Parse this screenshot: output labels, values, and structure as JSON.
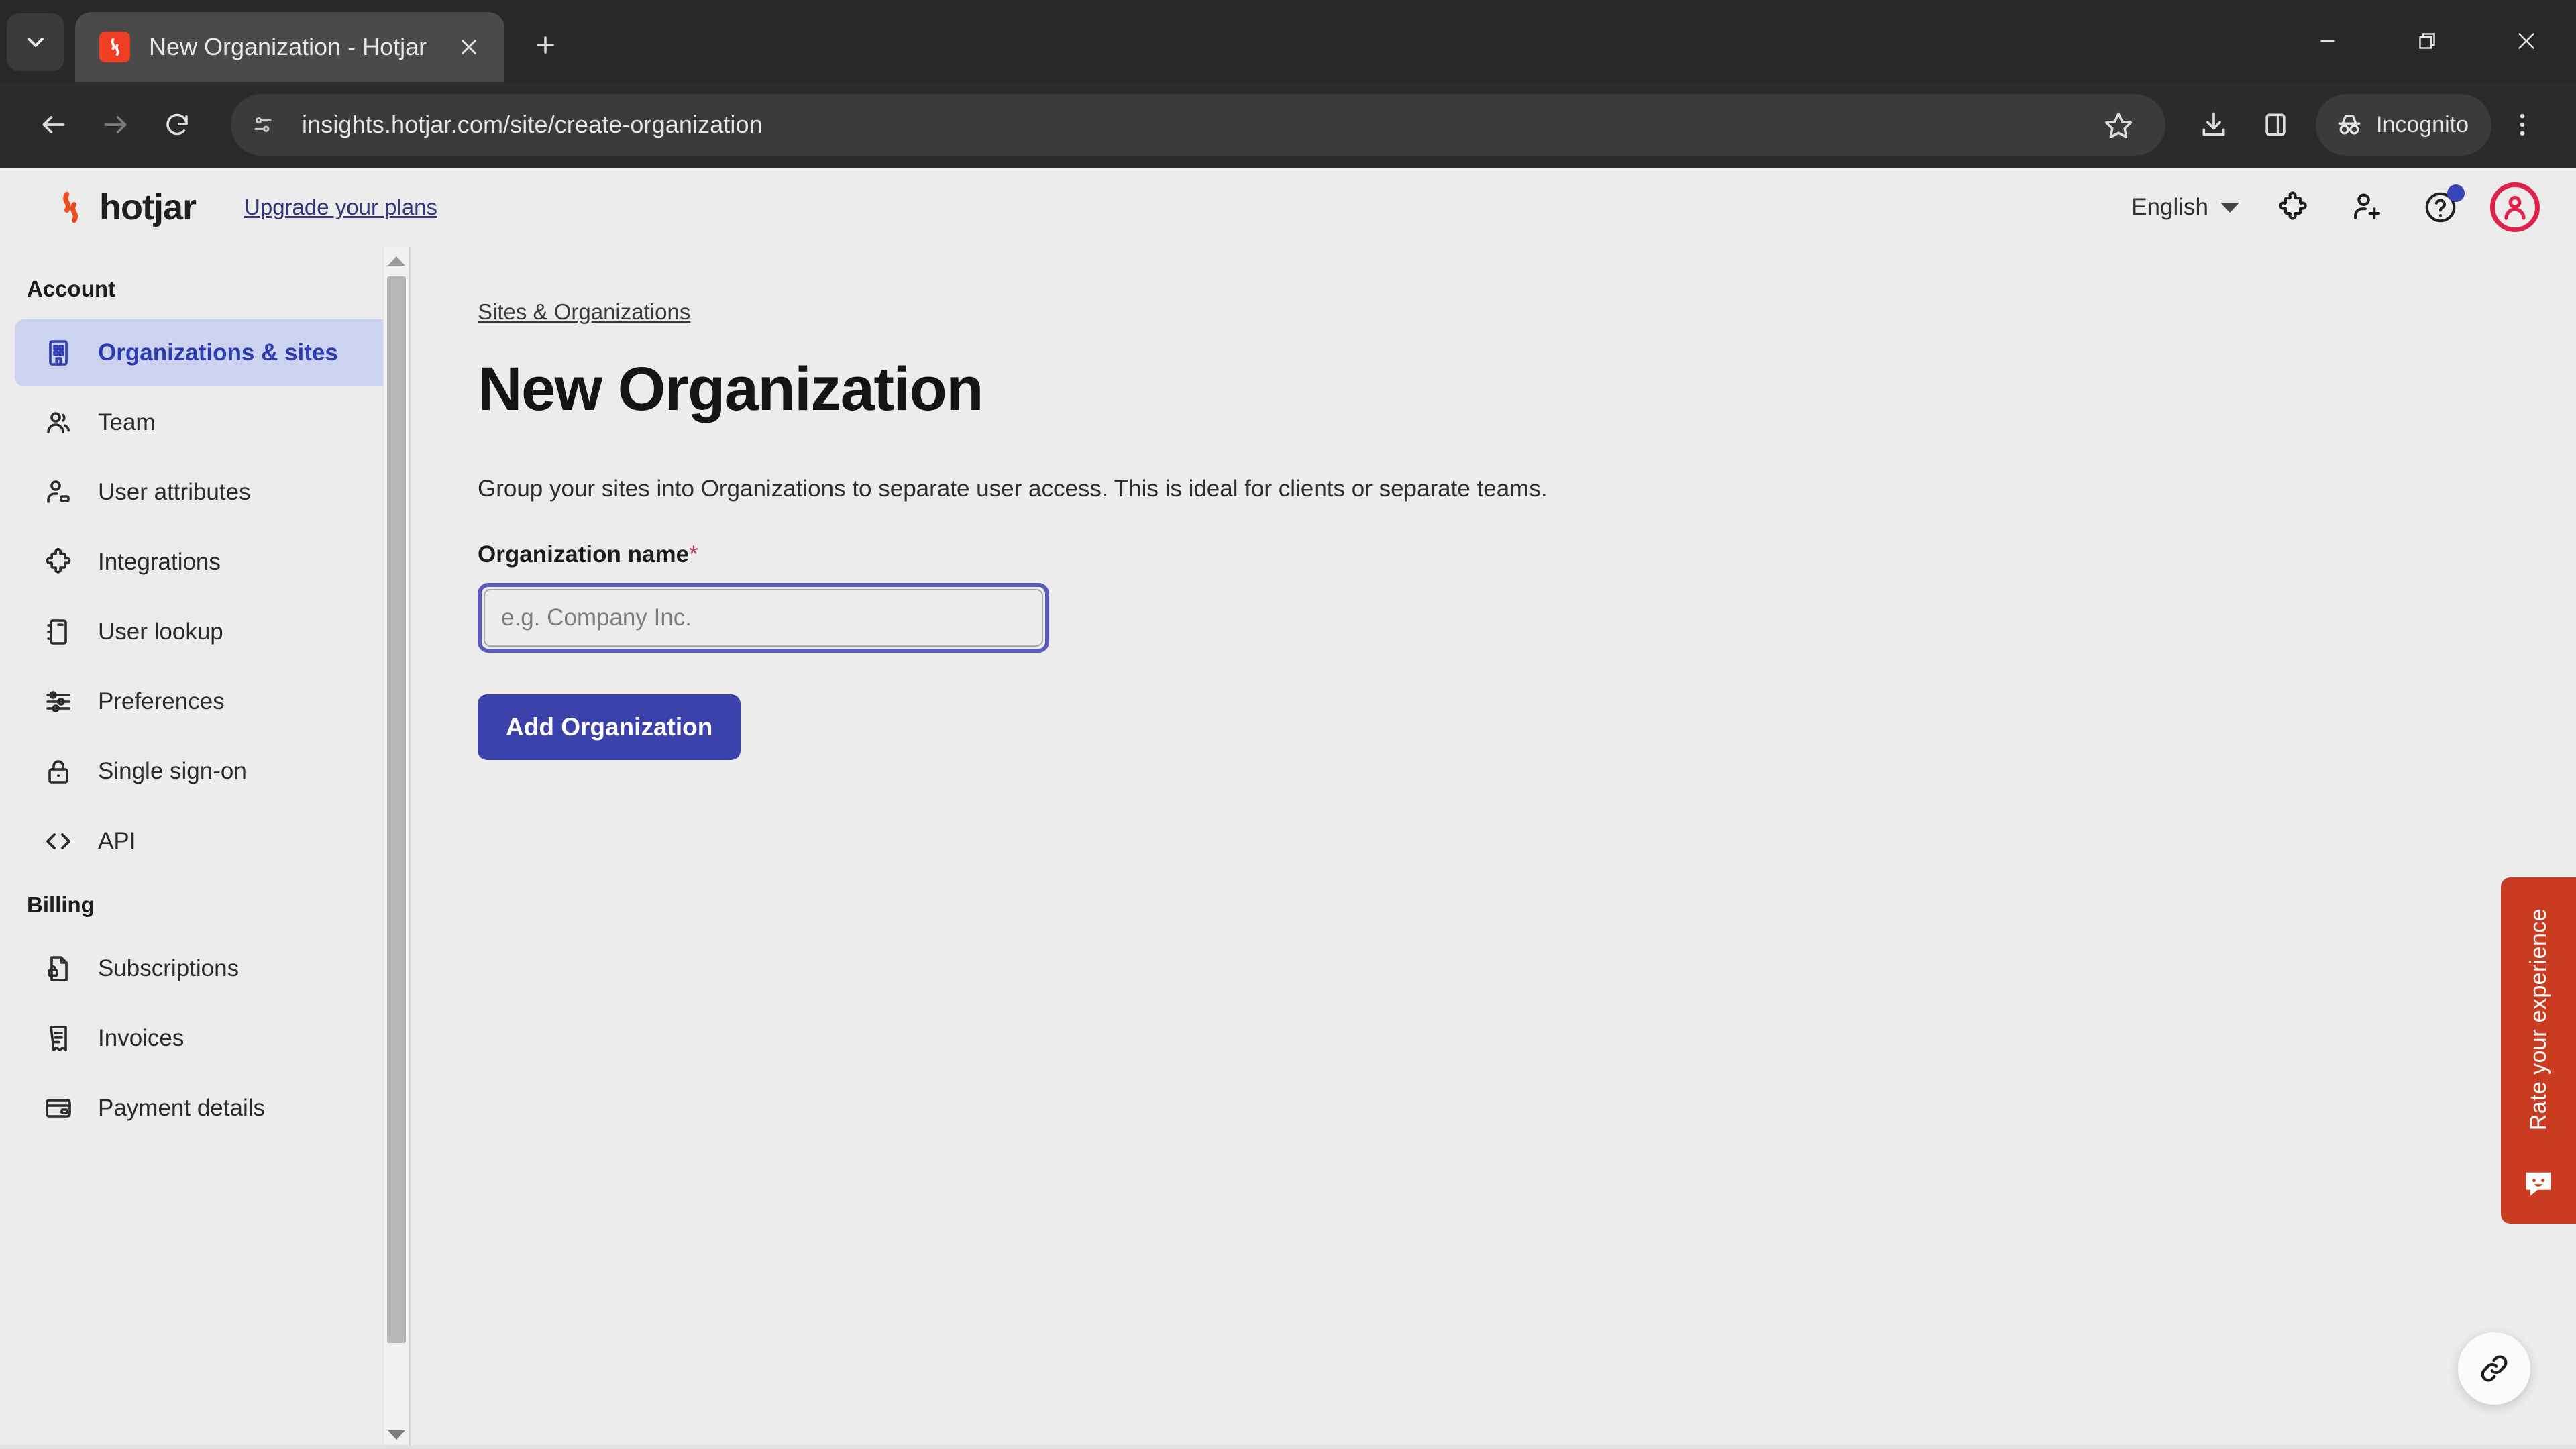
{
  "browser": {
    "tab": {
      "title": "New Organization - Hotjar",
      "favicon": "hotjar-favicon"
    },
    "tab_search_icon": "chevron-down-icon",
    "new_tab_icon": "plus-icon",
    "window_controls": {
      "minimize": "minimize-icon",
      "restore": "restore-icon",
      "close": "close-icon"
    },
    "toolbar": {
      "back_icon": "back-arrow-icon",
      "forward_icon": "forward-arrow-icon",
      "reload_icon": "reload-icon",
      "site_info_icon": "site-settings-icon",
      "url": "insights.hotjar.com/site/create-organization",
      "bookmark_icon": "star-icon",
      "download_icon": "download-icon",
      "side_panel_icon": "side-panel-icon",
      "incognito_label": "Incognito",
      "incognito_icon": "incognito-icon",
      "menu_icon": "kebab-menu-icon"
    }
  },
  "app_header": {
    "logo_text": "hotjar",
    "logo_icon": "hotjar-flame-icon",
    "upgrade_link": "Upgrade your plans",
    "language": "English",
    "caret_icon": "chevron-down-icon",
    "integrations_icon": "puzzle-icon",
    "invite_icon": "add-user-icon",
    "help_icon": "help-circle-icon",
    "has_notification": true,
    "avatar_icon": "user-avatar-icon"
  },
  "sidebar": {
    "groups": [
      {
        "title": "Account",
        "items": [
          {
            "label": "Organizations & sites",
            "icon": "building-icon",
            "active": true
          },
          {
            "label": "Team",
            "icon": "users-icon",
            "active": false
          },
          {
            "label": "User attributes",
            "icon": "user-tag-icon",
            "active": false
          },
          {
            "label": "Integrations",
            "icon": "puzzle-icon",
            "active": false
          },
          {
            "label": "User lookup",
            "icon": "notebook-icon",
            "active": false
          },
          {
            "label": "Preferences",
            "icon": "sliders-icon",
            "active": false
          },
          {
            "label": "Single sign-on",
            "icon": "lock-icon",
            "active": false
          },
          {
            "label": "API",
            "icon": "code-brackets-icon",
            "active": false
          }
        ]
      },
      {
        "title": "Billing",
        "items": [
          {
            "label": "Subscriptions",
            "icon": "document-lock-icon",
            "active": false
          },
          {
            "label": "Invoices",
            "icon": "receipt-icon",
            "active": false
          },
          {
            "label": "Payment details",
            "icon": "credit-card-icon",
            "active": false
          }
        ]
      }
    ],
    "scrollbar": {
      "up_arrow_icon": "scroll-up-arrow-icon",
      "down_arrow_icon": "scroll-down-arrow-icon"
    }
  },
  "main": {
    "breadcrumb": "Sites & Organizations",
    "title": "New Organization",
    "description": "Group your sites into Organizations to separate user access. This is ideal for clients or separate teams.",
    "form": {
      "label": "Organization name",
      "required_marker": "*",
      "input_value": "",
      "input_placeholder": "e.g. Company Inc.",
      "input_focused": true,
      "submit_label": "Add Organization"
    }
  },
  "feedback_tab": {
    "label": "Rate your experience",
    "icon": "smiley-chat-icon",
    "color": "#ca3c21"
  },
  "floating_button": {
    "icon": "link-chain-icon"
  },
  "colors": {
    "accent_indigo": "#3b42ab",
    "active_nav_bg": "#ccd3f0",
    "active_nav_text": "#2f3bb0",
    "hotjar_red": "#ef3e24",
    "avatar_ring": "#e0214c",
    "notification_blue": "#3b44b5",
    "required_star": "#c0395e",
    "page_bg": "#ececec"
  }
}
